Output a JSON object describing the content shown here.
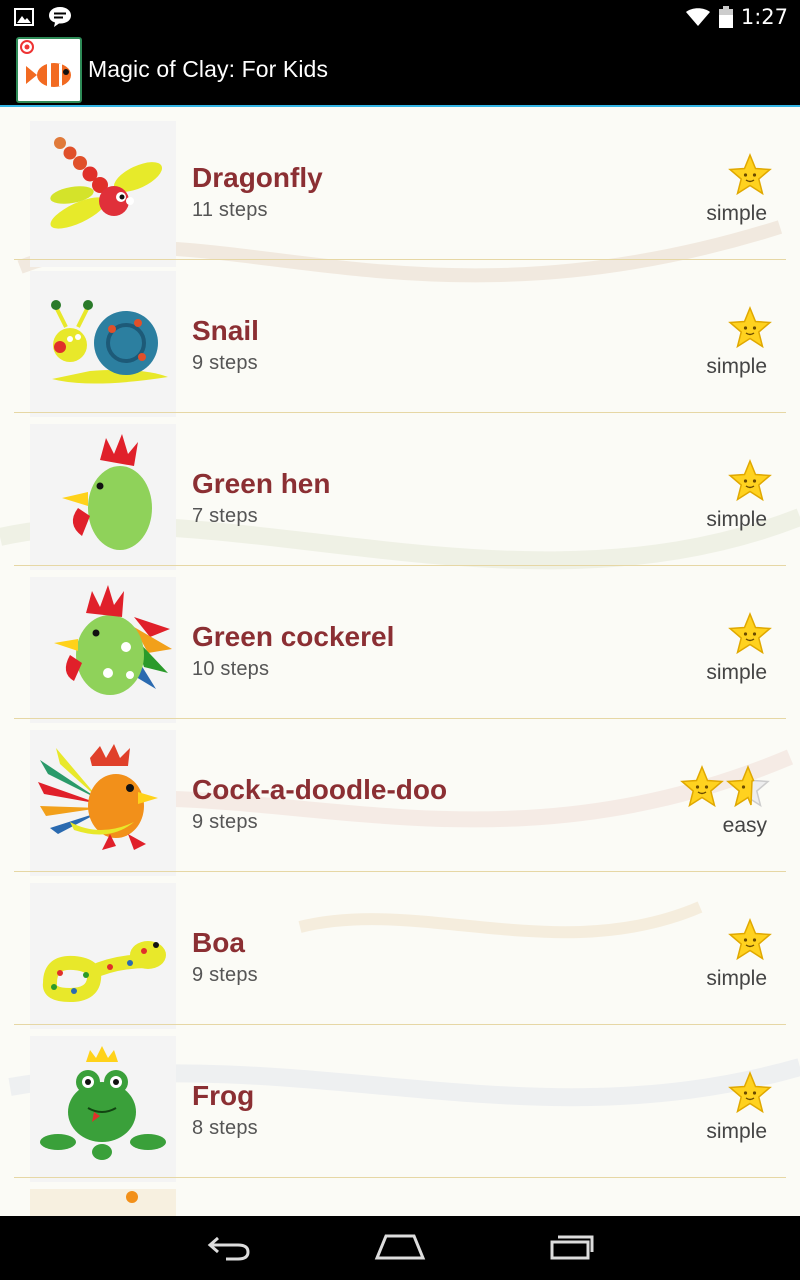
{
  "status_bar": {
    "time": "1:27",
    "icons": [
      "image-notification-icon",
      "chat-notification-icon",
      "wifi-icon",
      "battery-icon"
    ]
  },
  "app": {
    "title": "Magic of Clay: For Kids",
    "icon": "clownfish-app-icon"
  },
  "items": [
    {
      "title": "Dragonfly",
      "steps": "11 steps",
      "difficulty": "simple",
      "stars": 1
    },
    {
      "title": "Snail",
      "steps": "9 steps",
      "difficulty": "simple",
      "stars": 1
    },
    {
      "title": "Green hen",
      "steps": "7 steps",
      "difficulty": "simple",
      "stars": 1
    },
    {
      "title": "Green cockerel",
      "steps": "10 steps",
      "difficulty": "simple",
      "stars": 1
    },
    {
      "title": "Cock-a-doodle-doo",
      "steps": "9 steps",
      "difficulty": "easy",
      "stars": 2
    },
    {
      "title": "Boa",
      "steps": "9 steps",
      "difficulty": "simple",
      "stars": 1
    },
    {
      "title": "Frog",
      "steps": "8 steps",
      "difficulty": "simple",
      "stars": 1
    }
  ],
  "colors": {
    "title": "#8b2f33",
    "star": "#ffd21f",
    "divider": "#e6d7a5",
    "accent": "#33b5e5"
  },
  "nav_bar": {
    "buttons": [
      "back-icon",
      "home-icon",
      "recent-apps-icon"
    ]
  }
}
